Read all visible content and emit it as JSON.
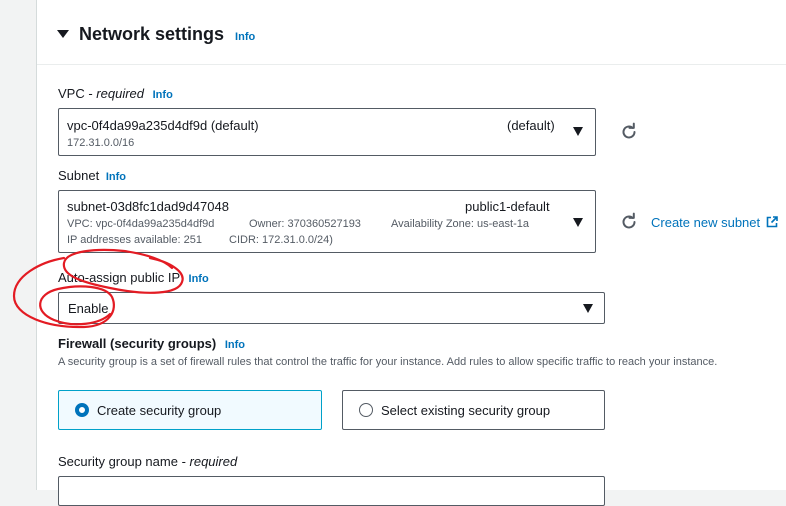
{
  "section": {
    "title": "Network settings",
    "info": "Info"
  },
  "vpc": {
    "label": "VPC - ",
    "required": "required",
    "info": "Info",
    "value": "vpc-0f4da99a235d4df9d (default)",
    "badge": "(default)",
    "cidr": "172.31.0.0/16"
  },
  "subnet": {
    "label": "Subnet",
    "info": "Info",
    "value": "subnet-03d8fc1dad9d47048",
    "badge": "public1-default",
    "detail_vpc": "VPC: vpc-0f4da99a235d4df9d",
    "detail_owner": "Owner: 370360527193",
    "detail_az": "Availability Zone: us-east-1a",
    "detail_ips": "IP addresses available: 251",
    "detail_cidr": "CIDR: 172.31.0.0/24)",
    "create_link": "Create new subnet"
  },
  "auto_ip": {
    "label": "Auto-assign public IP",
    "info": "Info",
    "value": "Enable"
  },
  "firewall": {
    "title": "Firewall (security groups)",
    "info": "Info",
    "description": "A security group is a set of firewall rules that control the traffic for your instance. Add rules to allow specific traffic to reach your instance.",
    "option_create": "Create security group",
    "option_existing": "Select existing security group",
    "selected": "create"
  },
  "sg_name": {
    "label": "Security group name - ",
    "required": "required"
  },
  "colors": {
    "accent": "#0073bb",
    "selected_bg": "#f1faff",
    "annotation": "#e31b23"
  }
}
